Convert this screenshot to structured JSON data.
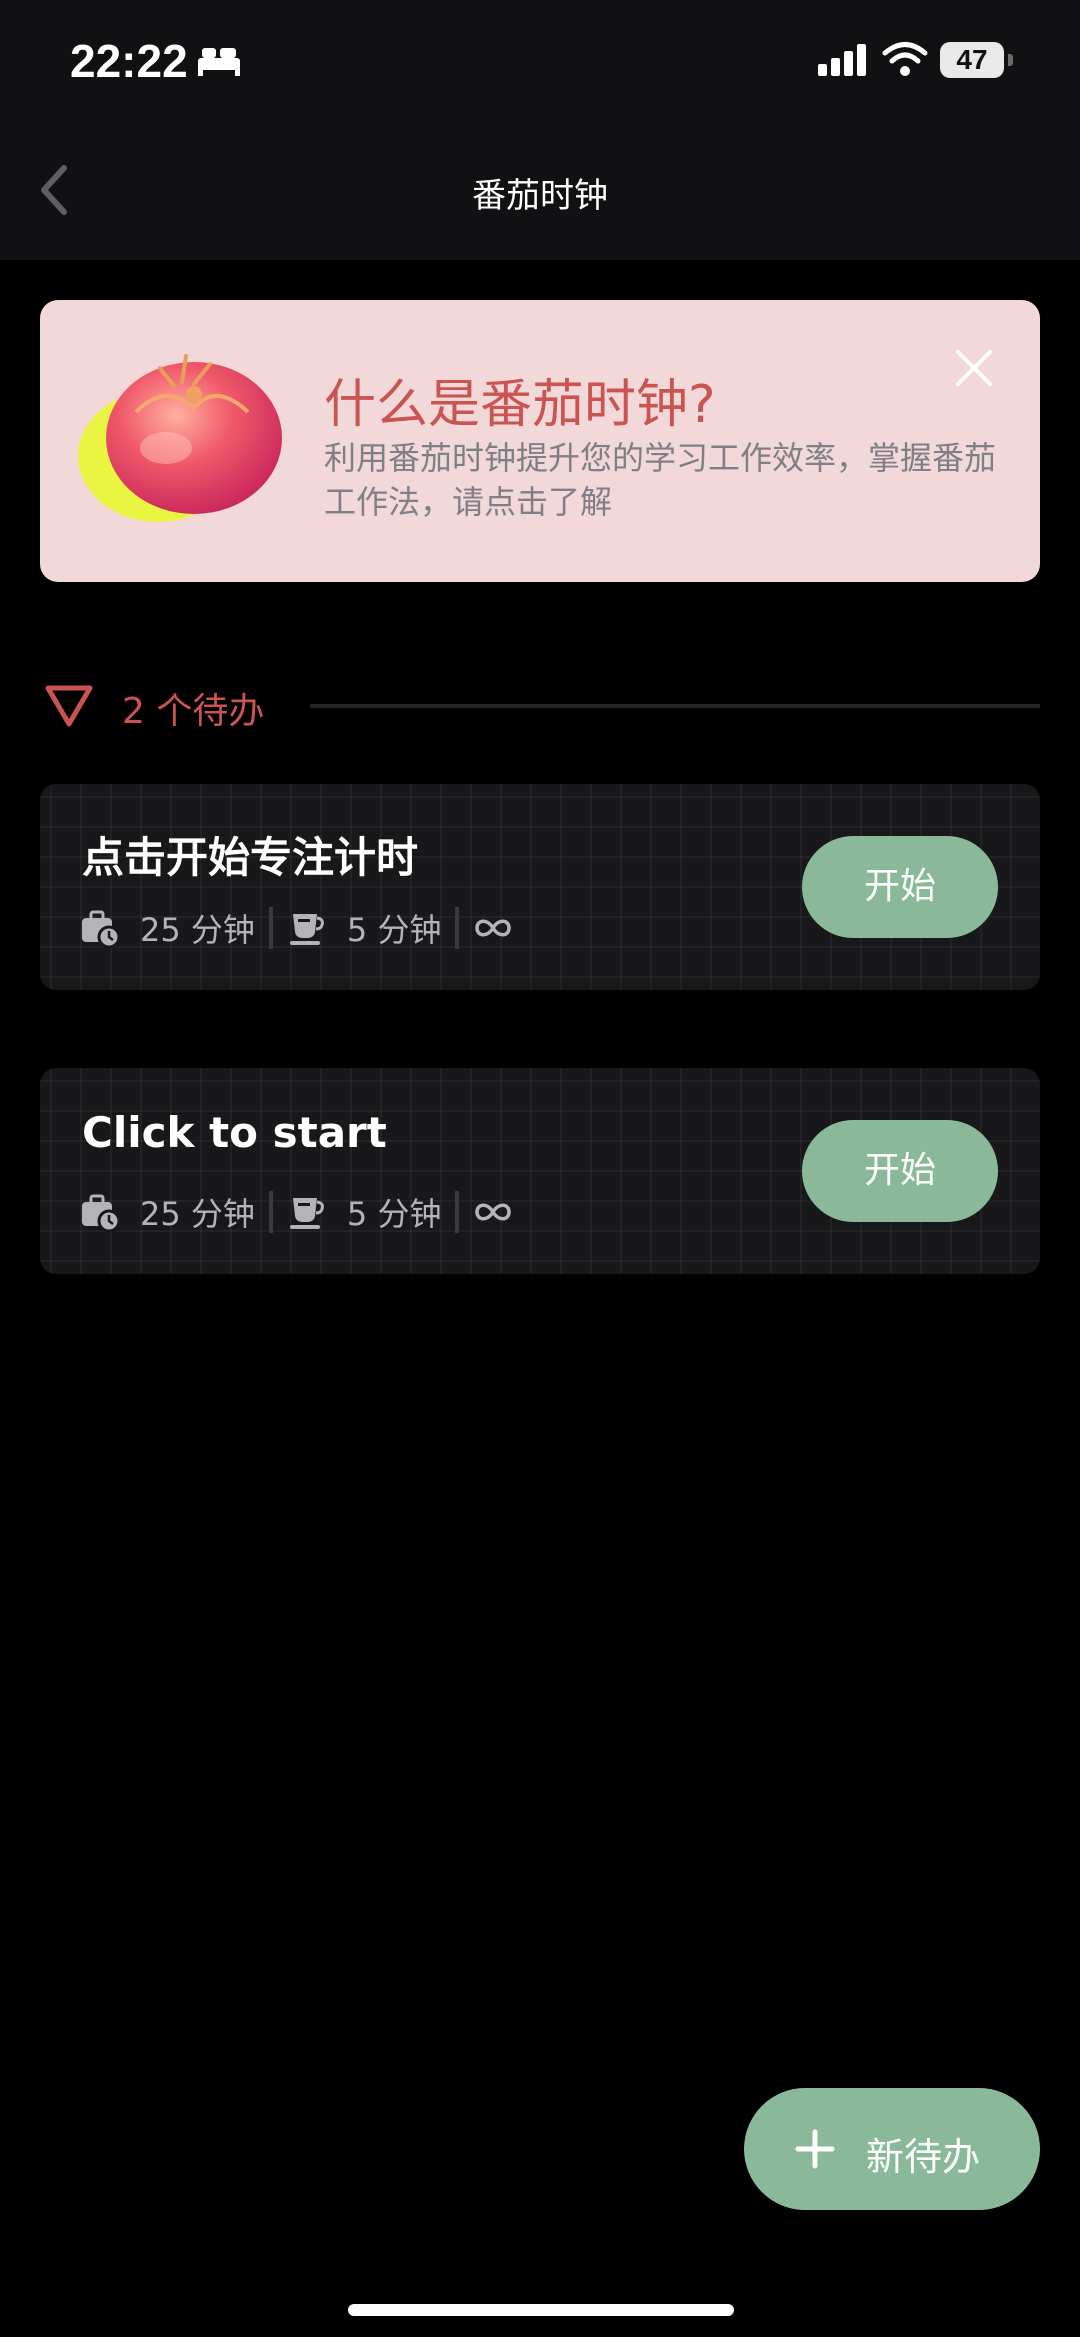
{
  "status_bar": {
    "time": "22:22",
    "battery": "47",
    "icons": [
      "bed-icon",
      "signal-icon",
      "wifi-icon",
      "battery-icon"
    ]
  },
  "nav": {
    "title": "番茄时钟",
    "back_icon": "chevron-left-icon"
  },
  "banner": {
    "title": "什么是番茄时钟?",
    "description": "利用番茄时钟提升您的学习工作效率，掌握番茄工作法，请点击了解",
    "illustration": "tomato-illustration",
    "close_icon": "close-icon",
    "background": "#f2d8d8",
    "accent": "#c95452"
  },
  "section": {
    "count_label": "2 个待办",
    "toggle_icon": "triangle-down-icon"
  },
  "tasks": [
    {
      "title": "点击开始专注计时",
      "focus": "25 分钟",
      "break": "5 分钟",
      "repeat_icon": "infinity-icon",
      "start_label": "开始"
    },
    {
      "title": "Click to start",
      "focus": "25 分钟",
      "break": "5 分钟",
      "repeat_icon": "infinity-icon",
      "start_label": "开始"
    }
  ],
  "fab": {
    "label": "新待办",
    "icon": "plus-icon",
    "color": "#8ab99a"
  }
}
